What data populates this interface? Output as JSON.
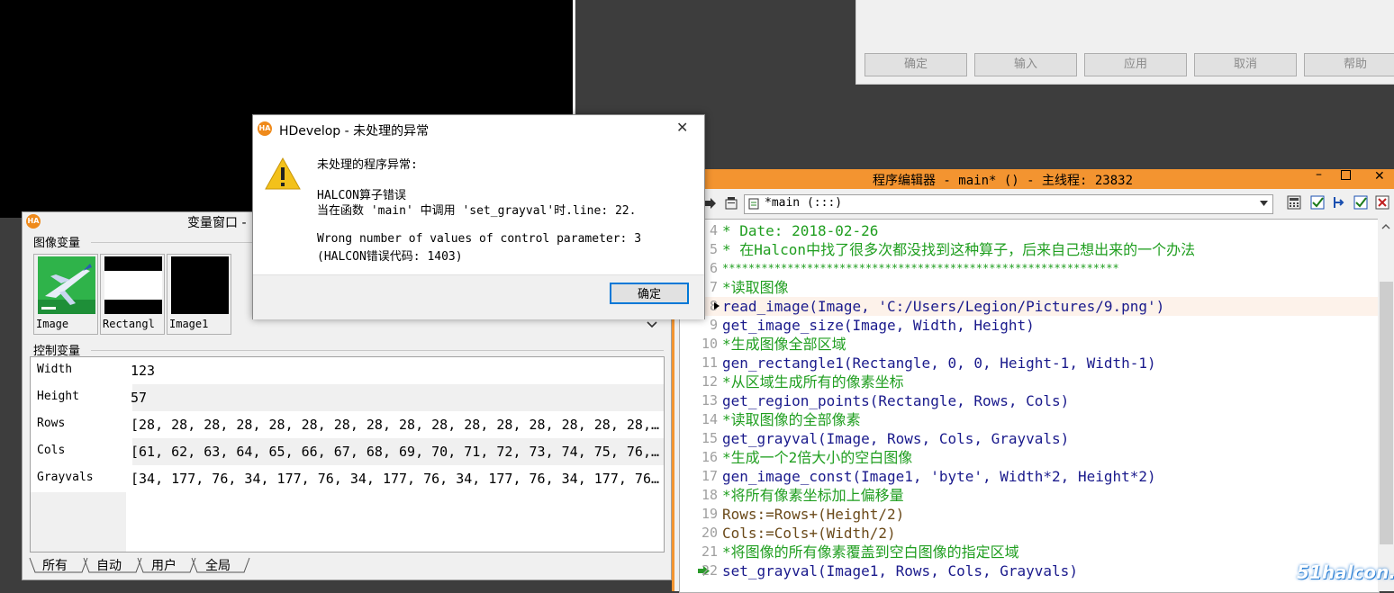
{
  "top_dialog": {
    "buttons": [
      "确定",
      "输入",
      "应用",
      "取消",
      "帮助"
    ]
  },
  "variable_window": {
    "title": "变量窗口 -",
    "image_section_label": "图像变量",
    "images": [
      {
        "label": "Image"
      },
      {
        "label": "Rectangl"
      },
      {
        "label": "Image1"
      }
    ],
    "control_section_label": "控制变量",
    "control_variables": [
      {
        "name": "Width",
        "value": "123"
      },
      {
        "name": "Height",
        "value": "57"
      },
      {
        "name": "Rows",
        "value": "[28, 28, 28, 28, 28, 28, 28, 28, 28, 28, 28, 28, 28, 28, 28, 28,…"
      },
      {
        "name": "Cols",
        "value": "[61, 62, 63, 64, 65, 66, 67, 68, 69, 70, 71, 72, 73, 74, 75, 76,…"
      },
      {
        "name": "Grayvals",
        "value": "[34, 177, 76, 34, 177, 76, 34, 177, 76, 34, 177, 76, 34, 177, 76…"
      }
    ],
    "tabs": [
      "所有",
      "自动",
      "用户",
      "全局"
    ]
  },
  "editor": {
    "title": "程序编辑器 - main* () - 主线程: 23832",
    "procedure_select": "*main (:::)",
    "lines": [
      {
        "num": "4",
        "text": "* Date:   2018-02-26",
        "kind": "comment"
      },
      {
        "num": "5",
        "text": "* 在Halcon中找了很多次都没找到这种算子，后来自己想出来的一个办法",
        "kind": "comment"
      },
      {
        "num": "6",
        "text": "*************************************************************",
        "kind": "comment"
      },
      {
        "num": "7",
        "text": "*读取图像",
        "kind": "comment"
      },
      {
        "num": "8",
        "text": "read_image(Image, 'C:/Users/Legion/Pictures/9.png')",
        "kind": "op"
      },
      {
        "num": "9",
        "text": "get_image_size(Image, Width, Height)",
        "kind": "op"
      },
      {
        "num": "10",
        "text": "*生成图像全部区域",
        "kind": "comment"
      },
      {
        "num": "11",
        "text": "gen_rectangle1(Rectangle, 0, 0, Height-1, Width-1)",
        "kind": "op"
      },
      {
        "num": "12",
        "text": "*从区域生成所有的像素坐标",
        "kind": "comment"
      },
      {
        "num": "13",
        "text": "get_region_points(Rectangle, Rows, Cols)",
        "kind": "op"
      },
      {
        "num": "14",
        "text": "*读取图像的全部像素",
        "kind": "comment"
      },
      {
        "num": "15",
        "text": "get_grayval(Image, Rows, Cols, Grayvals)",
        "kind": "op"
      },
      {
        "num": "16",
        "text": "*生成一个2倍大小的空白图像",
        "kind": "comment"
      },
      {
        "num": "17",
        "text": "gen_image_const(Image1, 'byte', Width*2, Height*2)",
        "kind": "op"
      },
      {
        "num": "18",
        "text": "*将所有像素坐标加上偏移量",
        "kind": "comment"
      },
      {
        "num": "19",
        "text": "Rows:=Rows+(Height/2)",
        "kind": "assign"
      },
      {
        "num": "20",
        "text": "Cols:=Cols+(Width/2)",
        "kind": "assign"
      },
      {
        "num": "21",
        "text": "*将图像的所有像素覆盖到空白图像的指定区域",
        "kind": "comment"
      },
      {
        "num": "22",
        "text": "set_grayval(Image1, Rows, Cols, Grayvals)",
        "kind": "op"
      }
    ]
  },
  "modal": {
    "title": "HDevelop - 未处理的异常",
    "heading": "未处理的程序异常:",
    "line1": "HALCON算子错误",
    "line2": "当在函数 'main' 中调用 'set_grayval'时.line: 22.",
    "line3": "Wrong number of values of control parameter: 3",
    "line4": "(HALCON错误代码: 1403)",
    "ok_label": "确定"
  },
  "logo_text": "HA",
  "watermark": "51halcon.com",
  "colors": {
    "accent_orange": "#f39430",
    "comment_green": "#1f9e1f",
    "operator_blue": "#1a1a8c"
  }
}
